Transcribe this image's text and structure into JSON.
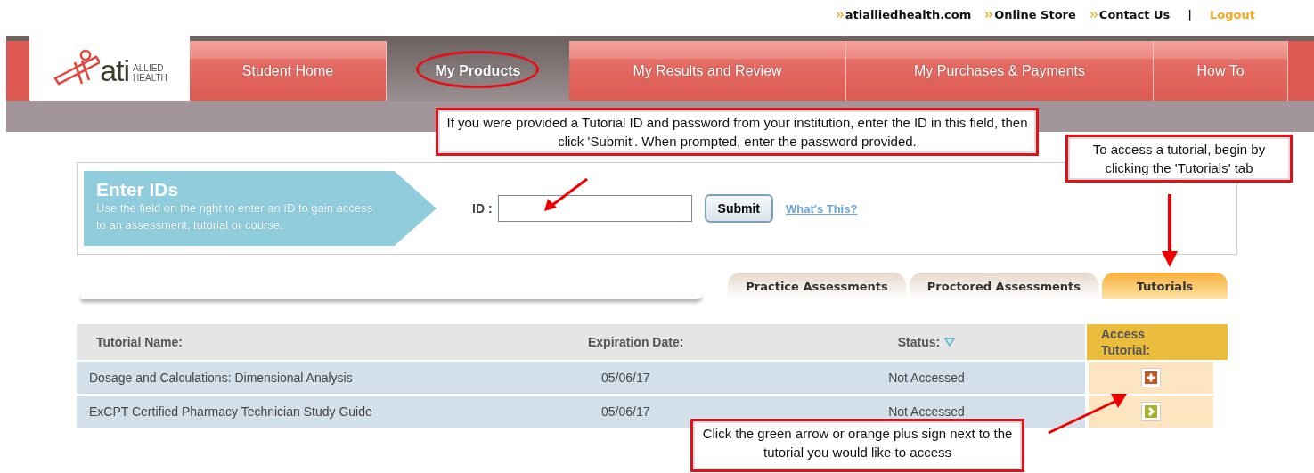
{
  "top_links": [
    {
      "label": "atialliedhealth.com",
      "kind": "link"
    },
    {
      "label": "Online Store",
      "kind": "link"
    },
    {
      "label": "Contact Us",
      "kind": "link"
    },
    {
      "label": "|",
      "kind": "separator"
    },
    {
      "label": "Logout",
      "kind": "logout"
    }
  ],
  "logo": {
    "wordmark": "ati",
    "tagline_1": "ALLIED",
    "tagline_2": "HEALTH"
  },
  "nav": [
    {
      "label": "Student Home",
      "selected": false
    },
    {
      "label": "My Products",
      "selected": true
    },
    {
      "label": "My Results and Review",
      "selected": false
    },
    {
      "label": "My Purchases & Payments",
      "selected": false
    },
    {
      "label": "How To",
      "selected": false
    }
  ],
  "enter_ids": {
    "title": "Enter IDs",
    "description": "Use the field on the right to enter an ID to gain access to an assessment, tutorial or course.",
    "field_label": "ID :",
    "submit": "Submit",
    "help_link": "What's This?"
  },
  "tabs": [
    {
      "label": "Practice Assessments",
      "selected": false
    },
    {
      "label": "Proctored Assessments",
      "selected": false
    },
    {
      "label": "Tutorials",
      "selected": true
    }
  ],
  "table": {
    "columns": [
      "Tutorial Name:",
      "Expiration Date:",
      "Status:",
      "Access Tutorial:"
    ],
    "rows": [
      {
        "name": "Dosage and Calculations: Dimensional Analysis",
        "expiration": "05/06/17",
        "status": "Not Accessed",
        "kind": "plus"
      },
      {
        "name": "ExCPT Certified Pharmacy Technician Study Guide",
        "expiration": "05/06/17",
        "status": "Not Accessed",
        "kind": "arrow"
      }
    ]
  },
  "callouts": [
    {
      "text": "If you were provided a Tutorial ID and password from your institution, enter the ID in this field, then click 'Submit'. When prompted, enter the password provided.",
      "kind": "id"
    },
    {
      "text": "To access a tutorial, begin by clicking the 'Tutorials' tab",
      "kind": "tab"
    },
    {
      "text": "Click the green arrow or orange plus sign next to the tutorial you would like to access",
      "kind": "access"
    }
  ]
}
